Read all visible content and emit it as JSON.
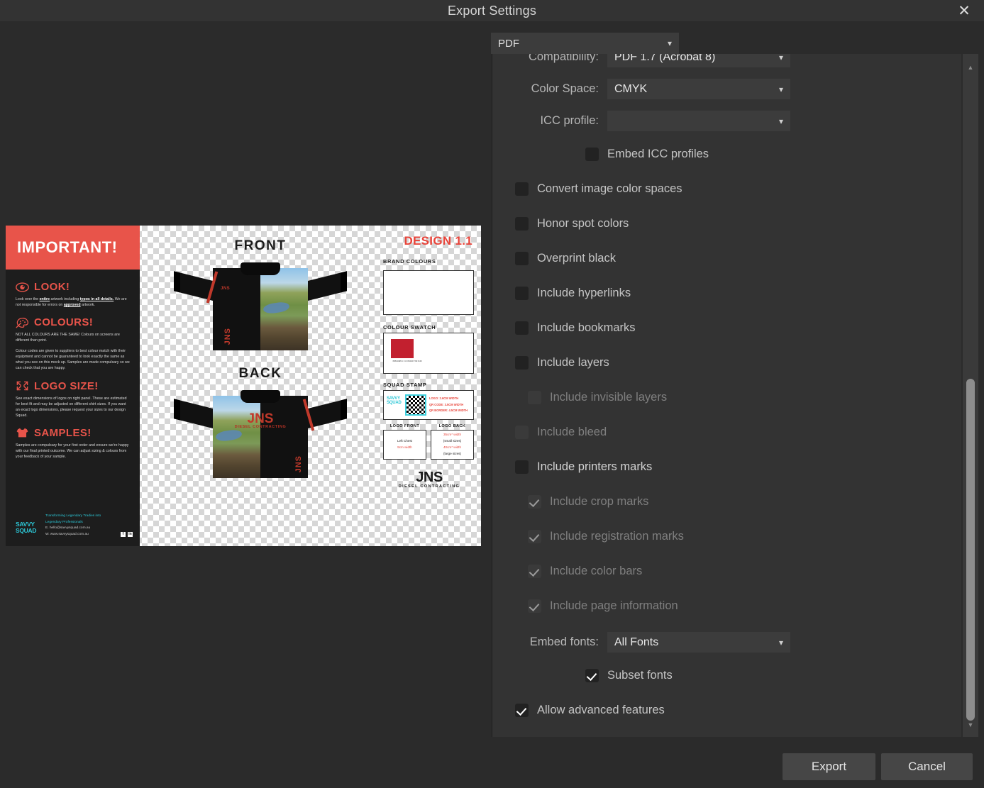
{
  "window": {
    "title": "Export Settings",
    "close_icon": "close-icon"
  },
  "format": {
    "value": "PDF",
    "chevron": "⌄"
  },
  "settings": {
    "compatibility": {
      "label": "Compatibility:",
      "value": "PDF 1.7 (Acrobat 8)"
    },
    "color_space": {
      "label": "Color Space:",
      "value": "CMYK"
    },
    "icc_profile": {
      "label": "ICC profile:",
      "value": ""
    },
    "embed_fonts": {
      "label": "Embed fonts:",
      "value": "All Fonts"
    },
    "checkboxes": [
      {
        "label": "Embed ICC profiles",
        "checked": false,
        "disabled": false
      },
      {
        "label": "Convert image color spaces",
        "checked": false,
        "disabled": false
      },
      {
        "label": "Honor spot colors",
        "checked": false,
        "disabled": false
      },
      {
        "label": "Overprint black",
        "checked": false,
        "disabled": false
      },
      {
        "label": "Include hyperlinks",
        "checked": false,
        "disabled": false
      },
      {
        "label": "Include bookmarks",
        "checked": false,
        "disabled": false
      },
      {
        "label": "Include layers",
        "checked": false,
        "disabled": false
      },
      {
        "label": "Include invisible layers",
        "checked": false,
        "disabled": true
      },
      {
        "label": "Include bleed",
        "checked": false,
        "disabled": true
      },
      {
        "label": "Include printers marks",
        "checked": false,
        "disabled": false
      },
      {
        "label": "Include crop marks",
        "checked": true,
        "disabled": true
      },
      {
        "label": "Include registration marks",
        "checked": true,
        "disabled": true
      },
      {
        "label": "Include color bars",
        "checked": true,
        "disabled": true
      },
      {
        "label": "Include page information",
        "checked": true,
        "disabled": true
      },
      {
        "label": "Subset fonts",
        "checked": true,
        "disabled": false
      },
      {
        "label": "Allow advanced features",
        "checked": true,
        "disabled": false
      }
    ]
  },
  "footer": {
    "export_label": "Export",
    "cancel_label": "Cancel"
  },
  "scrollbar": {
    "up_arrow": "▲",
    "down_arrow": "▼"
  },
  "preview": {
    "info_panel": {
      "banner": "IMPORTANT!",
      "sections": [
        {
          "icon": "eye-icon",
          "heading": "LOOK!",
          "paragraphs": [
            "Look over the <b>entire</b> artwork including <b>typos in all details.</b> We are not responsible for errors on <b>approved</b> artwork."
          ]
        },
        {
          "icon": "palette-icon",
          "heading": "COLOURS!",
          "paragraphs": [
            "NOT ALL COLOURS ARE THE SAME! Colours on screens are different than print.",
            "Colour codes are given to suppliers to best colour match with their equipment and cannot be guaranteed to look exactly the same as what you see on this mock up. Samples are made compulsary so we can check that you are happy."
          ]
        },
        {
          "icon": "resize-arrows-icon",
          "heading": "LOGO SIZE!",
          "paragraphs": [
            "See exact dimensions of logos on right panel. These are estimated for best fit and may be adjusted on different shirt sizes. If you want an exact logo dimensions, please request your sizes to our design Squad."
          ]
        },
        {
          "icon": "tshirt-icon",
          "heading": "SAMPLES!",
          "paragraphs": [
            "Samples are compulsary for your first order and ensure we're happy with our final printed outcome. We can adjust sizing & colours from your feedback of your sample."
          ]
        }
      ],
      "brand_logo": "SAVVY SQUAD",
      "tagline": "Transforming Legendary Tradies into Legendary Professionals",
      "email": "E. hello@savvysquad.com.au",
      "website": "W. www.savvysquad.com.au",
      "social": [
        "f",
        "in"
      ]
    },
    "mockups": [
      {
        "label": "FRONT",
        "chest_logo": "JNS",
        "vertical_logo": "JNS"
      },
      {
        "label": "BACK",
        "back_logo": "JNS",
        "back_sub": "DIESEL CONTRACTING",
        "vertical_logo": "JNS"
      }
    ],
    "spec_panel": {
      "design_version": "DESIGN 1.1",
      "brand_colours_title": "BRAND COLOURS",
      "colour_swatch_title": "COLOUR SWATCH",
      "swatch_hex": "#c2202f",
      "swatch_code": "PMS 1945 C / C:0 M:100 Y:63 K:29",
      "squad_stamp_title": "SQUAD STAMP",
      "stamp_logo": "SAVVY SQUAD",
      "stamp_specs": [
        "LOGO: 2.6CM WIDTH",
        "QR CODE: 3.5CM WIDTH",
        "QR BORDER: 4.5CM WIDTH"
      ],
      "logo_front": {
        "title": "LOGO FRONT",
        "lines": [
          "Left Chest",
          "9cm width"
        ]
      },
      "logo_back": {
        "title": "LOGO BACK",
        "lines": [
          "35cm* width",
          "(small sizes)",
          "40cm* width",
          "(large sizes)"
        ]
      },
      "brand_mark": "JNS",
      "brand_mark_sub": "DIESEL CONTRACTING"
    }
  }
}
